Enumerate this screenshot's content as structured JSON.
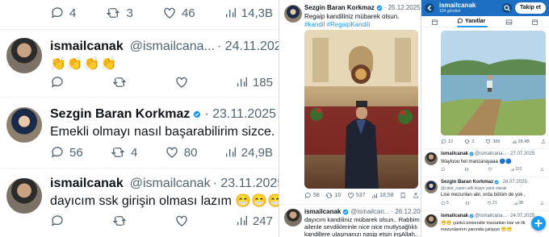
{
  "left": {
    "top_actions": {
      "replies": "4",
      "retweets": "3",
      "likes": "46",
      "views": "14,3B"
    },
    "tweets": [
      {
        "name": "ismailcanak",
        "handle": "@ismailcana...",
        "date": "· 24.11.2025",
        "text": "👏👏👏👏",
        "replies": "",
        "retweets": "",
        "likes": "",
        "views": "185"
      },
      {
        "name": "Sezgin Baran Korkmaz",
        "handle": "",
        "date": "· 23.11.2025",
        "text": "Emekli olmayı nasıl başarabilirim sizce.",
        "replies": "56",
        "retweets": "4",
        "likes": "80",
        "views": "24,9B"
      },
      {
        "name": "ismailcanak",
        "handle": "@ismailcanak",
        "date": "· 23.11.2025",
        "text": "dayıcım ssk girişin olması lazım 😁😁😁",
        "replies": "",
        "retweets": "",
        "likes": "",
        "views": "247"
      }
    ]
  },
  "middle": {
    "post": {
      "name": "Sezgin Baran Korkmaz",
      "date": "· 25.12.2025",
      "text": "Regaip kandiliniz mübarek olsun.",
      "hashtags": "#kandil #RegaipKandili",
      "replies": "58",
      "retweets": "10",
      "likes": "537",
      "views": "18,58"
    },
    "reply": {
      "name": "ismailcanak",
      "handle": "@ismailcan...",
      "date": "· 26.12.2025",
      "lines": [
        "dayıcım kandiliniz mübarek olsun.. Rabbim",
        "ailenle sevdiklerinle nice nice mutlysağlıklı",
        "kandillere ulaşmanızı nasip etsin inşAllah.."
      ]
    }
  },
  "right": {
    "header": {
      "name": "ismailcanak",
      "subtitle": "104 gönderi",
      "follow": "Takip et"
    },
    "tabs": [
      "Yanıtlar"
    ],
    "post_stats": {
      "replies": "12",
      "retweets": "3",
      "likes": "389",
      "views": "28,4B"
    },
    "tweets": [
      {
        "name": "ismailcanak",
        "handle": "@ismailcana...",
        "date": "· 27.07.2025",
        "text": "Waylooo hel manzarayaaa 🔵🔵",
        "views": "110"
      },
      {
        "name": "Sezgin Baran Korkmaz",
        "handle": "",
        "date": "· 24.07.2025",
        "mention": "@cakir_rusen adlı kişiye yanıt olarak",
        "text": "Lise mezunları abi, orda bölüm de yok ,",
        "replies": "5",
        "likes": "21",
        "views": "3B"
      },
      {
        "name": "ismailcanak",
        "handle": "@ismailcana...",
        "date": "· 24.07.2025",
        "lines": [
          "😁😁 çünkü üniversite mezunları lise ve ilk",
          "mezunlarının yanında çalışıyo 😁😁"
        ]
      }
    ]
  }
}
